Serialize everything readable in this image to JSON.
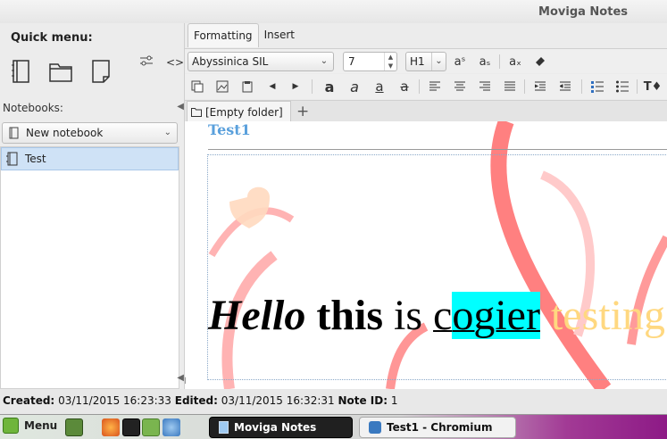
{
  "window": {
    "title": "Moviga Notes"
  },
  "quick_menu": {
    "title": "Quick menu:"
  },
  "notebooks": {
    "label": "Notebooks:",
    "new_notebook_label": "New notebook",
    "items": [
      {
        "label": "Test",
        "selected": true
      }
    ]
  },
  "editor_tabs": [
    {
      "label": "Formatting",
      "active": true
    },
    {
      "label": "Insert",
      "active": false
    }
  ],
  "formatting": {
    "font_family": "Abyssinica SIL",
    "font_size": "7",
    "heading": "H1",
    "superscript": "aˢ",
    "subscript": "aₛ",
    "size_sub": "aₓ"
  },
  "folder_tab": {
    "label": "[Empty folder]",
    "add_label": "+"
  },
  "note": {
    "title": "Test1",
    "words": {
      "w1": "Hello",
      "w2": "this",
      "w3": "is",
      "w4a": "c",
      "w4b": "ogier",
      "w5": "testing"
    },
    "colors": {
      "title": "#5aa0dc",
      "highlight": "#00ffff",
      "faint_text": "#ffd880"
    }
  },
  "status": {
    "created_label": "Created:",
    "created_value": "03/11/2015 16:23:33",
    "edited_label": "Edited:",
    "edited_value": "03/11/2015 16:32:31",
    "id_label": "Note ID:",
    "id_value": "1"
  },
  "taskbar": {
    "menu_label": "Menu",
    "tasks": [
      {
        "label": "Moviga Notes",
        "active": true
      },
      {
        "label": "Test1 - Chromium",
        "active": false
      }
    ]
  }
}
